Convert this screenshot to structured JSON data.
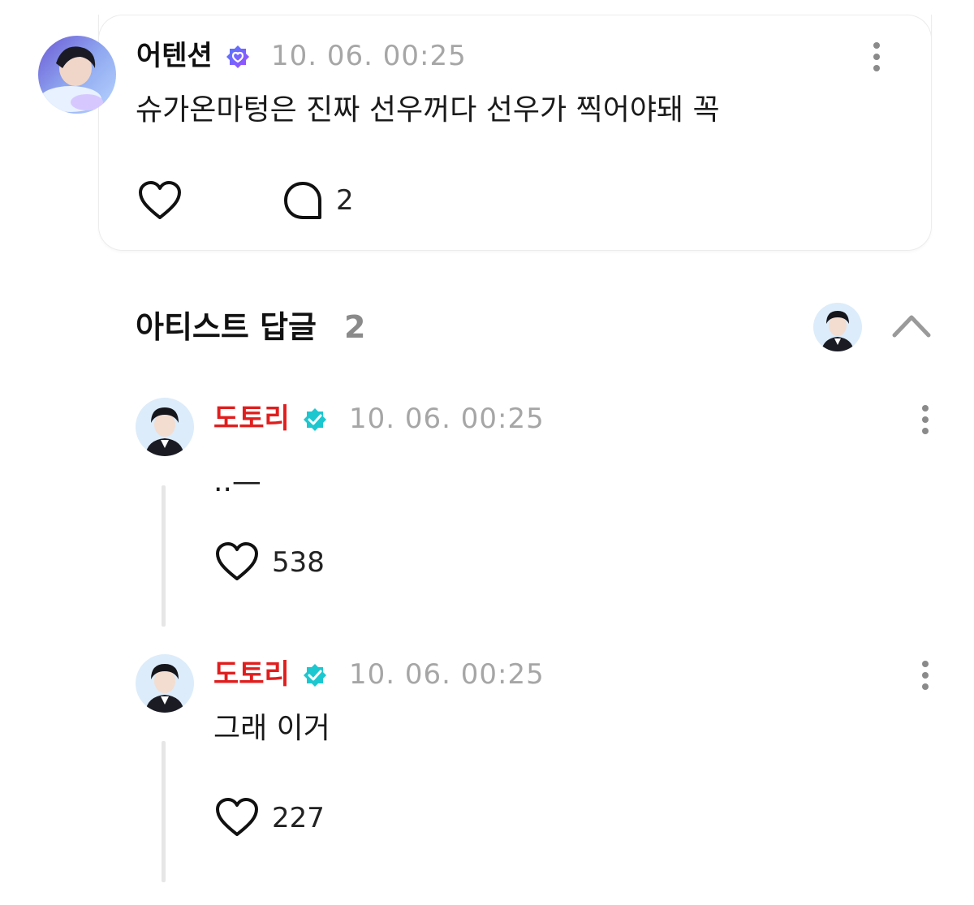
{
  "post": {
    "author": "어텐션",
    "author_badge_icon": "heart-verified-badge-icon",
    "timestamp": "10. 06. 00:25",
    "text": "슈가온마텅은 진짜 선우꺼다 선우가 찍어야돼 꼭",
    "like_icon": "heart-icon",
    "comment_icon": "comment-bubble-icon",
    "comment_count": "2"
  },
  "artist_replies": {
    "title": "아티스트 답글",
    "count": "2",
    "collapse_icon": "chevron-up-icon"
  },
  "replies": [
    {
      "author": "도토리",
      "author_color": "#e01e1e",
      "badge_icon": "verified-badge-icon",
      "badge_color": "#1cc7d0",
      "timestamp": "10. 06. 00:25",
      "text": "..—",
      "like_count": "538"
    },
    {
      "author": "도토리",
      "author_color": "#e01e1e",
      "badge_icon": "verified-badge-icon",
      "badge_color": "#1cc7d0",
      "timestamp": "10. 06. 00:25",
      "text": "그래 이거",
      "like_count": "227"
    }
  ],
  "colors": {
    "badge_purple": "#7b5cff",
    "badge_teal": "#1cc7d0",
    "artist_name": "#e01e1e",
    "muted_text": "#a6a6a6"
  }
}
